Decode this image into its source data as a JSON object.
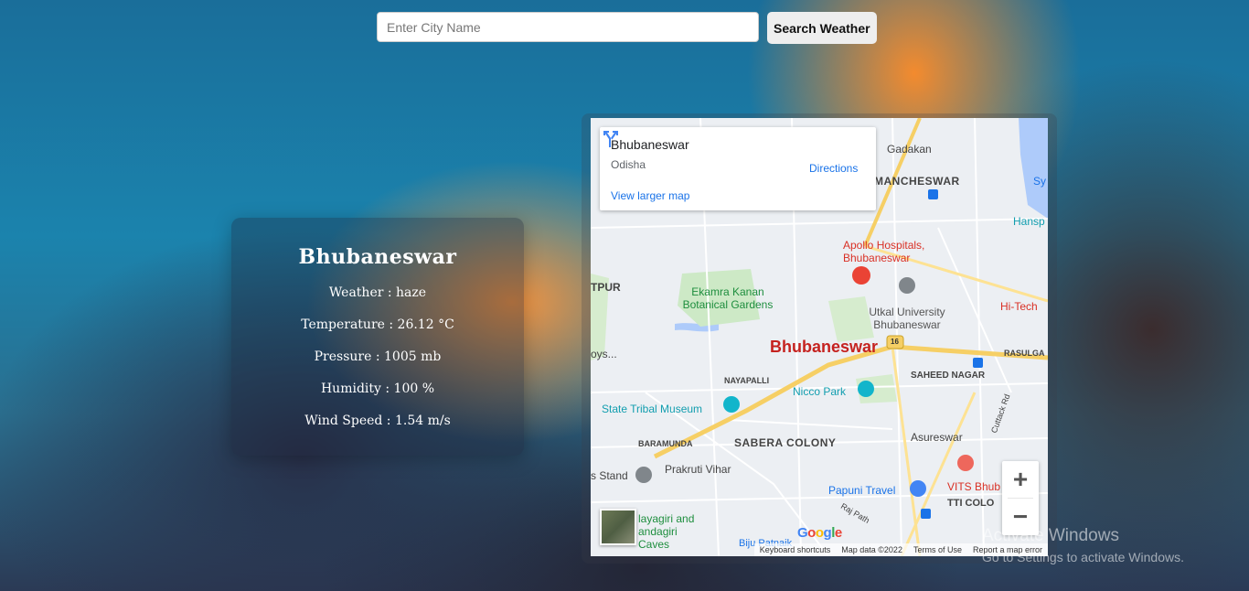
{
  "search": {
    "placeholder": "Enter City Name",
    "button_label": "Search Weather"
  },
  "weather": {
    "city": "Bhubaneswar",
    "weather": "Weather : haze",
    "temperature": "Temperature : 26.12 °C",
    "pressure": "Pressure : 1005 mb",
    "humidity": "Humidity : 100 %",
    "wind": "Wind Speed : 1.54 m/s"
  },
  "map": {
    "info_card": {
      "title": "Bhubaneswar",
      "subtitle": "Odisha",
      "directions_label": "Directions",
      "larger_map_link": "View larger map"
    },
    "center_label": "Bhubaneswar",
    "places": [
      "Gadakan",
      "MANCHESWAR",
      "Sy",
      "Hansp",
      "TPUR",
      "Apollo Hospitals, Bhubaneswar",
      "Ekamra Kanan Botanical Gardens",
      "Utkal University Bhubaneswar",
      "Hi-Tech",
      "RASULGA",
      "oys...",
      "NAYAPALLI",
      "SAHEED NAGAR",
      "Nicco Park",
      "State Tribal Museum",
      "BARAMUNDA",
      "SABERA COLONY",
      "Asureswar",
      "Cuttack Rd",
      "s Stand",
      "Prakruti Vihar",
      "VITS Bhub",
      "Papuni Travel",
      "TTI COLO",
      "layagiri and andagiri Caves",
      "Raj Path",
      "Biju Patnaik",
      "16"
    ],
    "attribution": [
      "Keyboard shortcuts",
      "Map data ©2022",
      "Terms of Use",
      "Report a map error"
    ],
    "google_logo": "Google",
    "zoom_in": "+",
    "zoom_out": "−"
  },
  "overlay": {
    "activate_title": "Activate Windows",
    "activate_sub": "Go to Settings to activate Windows."
  },
  "colors": {
    "map_background": "#eceff3",
    "link_blue": "#1a73e8",
    "city_label_red": "#c5221f",
    "park_green": "#cde9c6",
    "road_yellow": "#f6cf65"
  }
}
